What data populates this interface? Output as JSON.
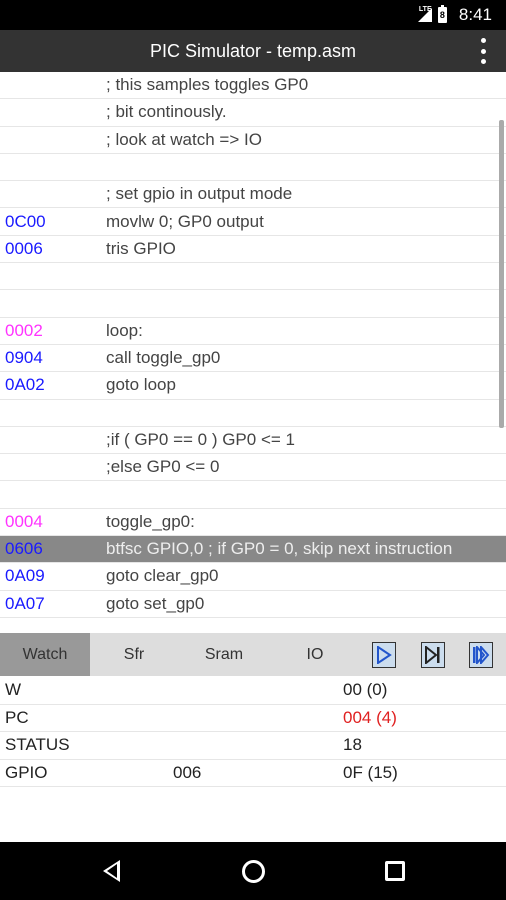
{
  "status_bar": {
    "signal_label": "LTE",
    "battery_label": "8",
    "time": "8:41"
  },
  "app_bar": {
    "title": "PIC Simulator - temp.asm"
  },
  "code_lines": [
    {
      "addr": "",
      "src": "; this samples toggles GP0",
      "kind": "normal"
    },
    {
      "addr": "",
      "src": "; bit continously.",
      "kind": "normal"
    },
    {
      "addr": "",
      "src": "; look at watch => IO",
      "kind": "normal"
    },
    {
      "addr": "",
      "src": "",
      "kind": "normal"
    },
    {
      "addr": "",
      "src": "; set gpio in output mode",
      "kind": "normal"
    },
    {
      "addr": "0C00",
      "src": "movlw   0; GP0 output",
      "kind": "normal"
    },
    {
      "addr": "0006",
      "src": "tris GPIO",
      "kind": "normal"
    },
    {
      "addr": "",
      "src": "",
      "kind": "normal"
    },
    {
      "addr": "",
      "src": "",
      "kind": "normal"
    },
    {
      "addr": "0002",
      "src": "loop:",
      "kind": "label"
    },
    {
      "addr": "0904",
      "src": "call toggle_gp0",
      "kind": "normal"
    },
    {
      "addr": "0A02",
      "src": "goto loop",
      "kind": "normal"
    },
    {
      "addr": "",
      "src": "",
      "kind": "normal"
    },
    {
      "addr": "",
      "src": ";if ( GP0 == 0 ) GP0 <= 1",
      "kind": "normal"
    },
    {
      "addr": "",
      "src": ";else GP0 <= 0",
      "kind": "normal"
    },
    {
      "addr": "",
      "src": "",
      "kind": "normal"
    },
    {
      "addr": "0004",
      "src": "toggle_gp0:",
      "kind": "label"
    },
    {
      "addr": "0606",
      "src": "btfsc GPIO,0 ; if GP0 = 0, skip next instruction",
      "kind": "selected"
    },
    {
      "addr": "0A09",
      "src": "goto clear_gp0",
      "kind": "normal"
    },
    {
      "addr": "0A07",
      "src": "goto set_gp0",
      "kind": "normal"
    }
  ],
  "tabs": {
    "watch": "Watch",
    "sfr": "Sfr",
    "sram": "Sram",
    "io": "IO"
  },
  "watch_rows": [
    {
      "name": "W",
      "addr": "",
      "val": "00 (0)",
      "changed": false
    },
    {
      "name": "PC",
      "addr": "",
      "val": "004 (4)",
      "changed": true
    },
    {
      "name": "STATUS",
      "addr": "",
      "val": "18",
      "changed": false
    },
    {
      "name": "GPIO",
      "addr": "006",
      "val": "0F (15)",
      "changed": false
    }
  ],
  "colors": {
    "address": "#1a1aff",
    "label_address": "#ff33ff",
    "changed_value": "#e02020",
    "selected_row": "#888888"
  },
  "icons": [
    "overflow-menu-icon",
    "play-icon",
    "step-icon",
    "run-fast-icon",
    "back-icon",
    "home-icon",
    "recents-icon"
  ]
}
